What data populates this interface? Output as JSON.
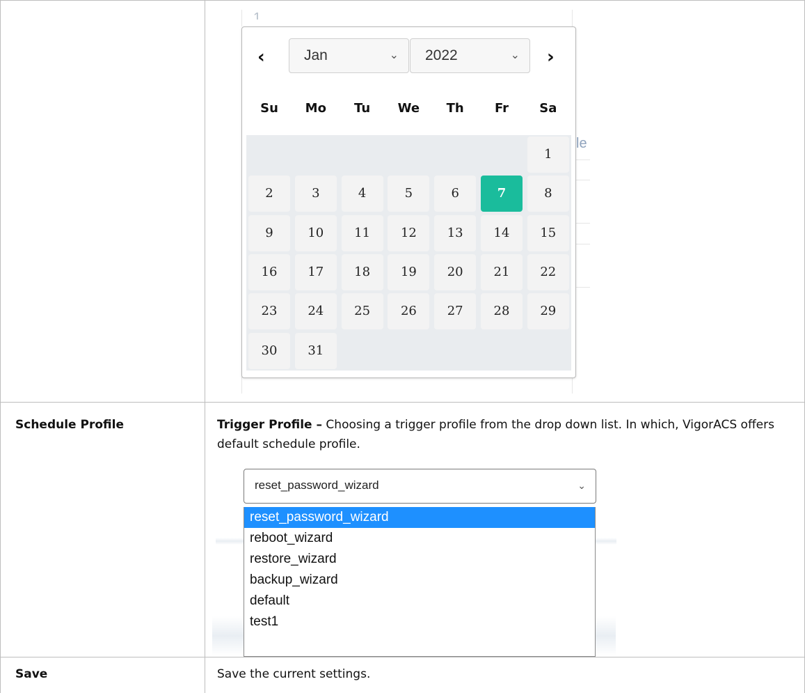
{
  "calendar": {
    "partial_top_digit": "1",
    "prev_label": "‹",
    "next_label": "›",
    "month_select": "Jan",
    "year_select": "2022",
    "weekdays": [
      "Su",
      "Mo",
      "Tu",
      "We",
      "Th",
      "Fr",
      "Sa"
    ],
    "days": [
      "1",
      "2",
      "3",
      "4",
      "5",
      "6",
      "7",
      "8",
      "9",
      "10",
      "11",
      "12",
      "13",
      "14",
      "15",
      "16",
      "17",
      "18",
      "19",
      "20",
      "21",
      "22",
      "23",
      "24",
      "25",
      "26",
      "27",
      "28",
      "29",
      "30",
      "31"
    ],
    "selected_day": "7",
    "behind_text": "le",
    "accent_color": "#1abc9c"
  },
  "rows": [
    {
      "name": "Schedule Profile",
      "desc_bold": "Trigger Profile –",
      "desc_text": " Choosing a trigger profile from the drop down list. In which, VigorACS offers default schedule profile."
    },
    {
      "name": "Save",
      "desc_text": "Save the current settings."
    }
  ],
  "dropdown": {
    "selected_value": "reset_password_wizard",
    "options": [
      "reset_password_wizard",
      "reboot_wizard",
      "restore_wizard",
      "backup_wizard",
      "default",
      "test1"
    ],
    "highlight_color": "#1e90ff"
  }
}
